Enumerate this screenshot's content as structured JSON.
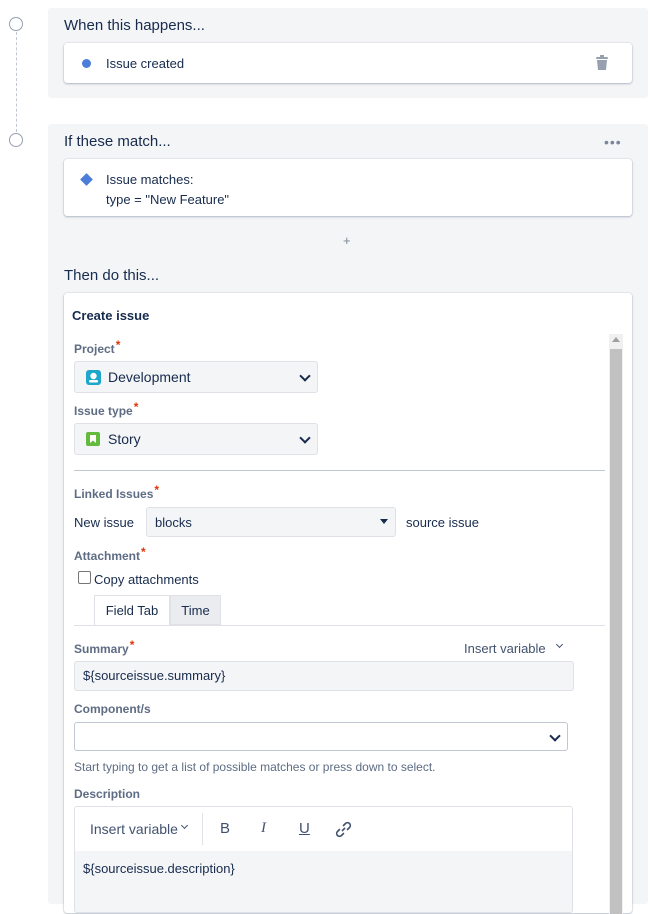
{
  "trigger": {
    "title": "When this happens...",
    "item_label": "Issue created"
  },
  "condition": {
    "title": "If these match...",
    "line1": "Issue matches:",
    "line2": "type = \"New Feature\"",
    "add_label": "+"
  },
  "action": {
    "title": "Then do this...",
    "card_title": "Create issue",
    "project": {
      "label": "Project",
      "required": "*",
      "value": "Development"
    },
    "issue_type": {
      "label": "Issue type",
      "required": "*",
      "value": "Story"
    },
    "linked": {
      "label": "Linked Issues",
      "required": "*",
      "prefix": "New issue",
      "value": "blocks",
      "suffix": "source issue"
    },
    "attachment": {
      "label": "Attachment",
      "required": "*",
      "checkbox_label": "Copy attachments"
    },
    "tabs": [
      "Field Tab",
      "Time"
    ],
    "summary": {
      "label": "Summary",
      "required": "*",
      "insert_variable": "Insert variable",
      "value": "${sourceissue.summary}"
    },
    "components": {
      "label": "Component/s",
      "value": "",
      "hint": "Start typing to get a list of possible matches or press down to select."
    },
    "description": {
      "label": "Description",
      "insert_variable": "Insert variable",
      "bold": "B",
      "italic": "I",
      "underline": "U",
      "value": "${sourceissue.description}"
    }
  },
  "colors": {
    "accent_blue": "#4c7dd9",
    "required_red": "#de350b",
    "project_icon": "#1fa7c9",
    "story_icon": "#63ba3c"
  },
  "icons": [
    "trash-icon",
    "more-icon",
    "project-icon",
    "story-icon",
    "link-icon"
  ]
}
